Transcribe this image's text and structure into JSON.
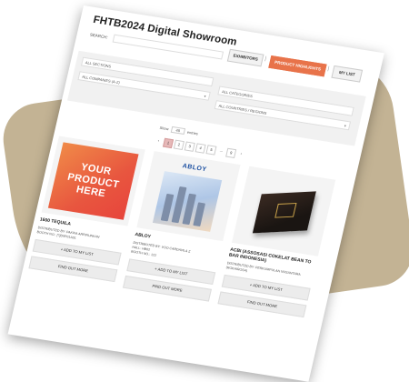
{
  "title": "FHTB2024 Digital Showroom",
  "search": {
    "label": "SEARCH:",
    "value": ""
  },
  "nav": {
    "exhibitors": "EXHIBITORS",
    "product_highlights": "PRODUCT HIGHLIGHTS",
    "my_list": "MY LIST",
    "separator": "|"
  },
  "filters": {
    "sections": "ALL SECTIONS",
    "companies": "ALL COMPANIES (A-Z)",
    "categories": "ALL CATEGORIES",
    "countries": "ALL COUNTRIES / REGIONS",
    "caret": "▾"
  },
  "entries": {
    "show": "Show",
    "count": "48",
    "suffix": "entries"
  },
  "pagination": [
    "‹",
    "1",
    "2",
    "3",
    "4",
    "5",
    "…",
    "9",
    "›"
  ],
  "pagination_active": "1",
  "products": [
    {
      "placeholder": "YOUR PRODUCT HERE",
      "name": "1600 TEQUILA",
      "distributed_label": "DISTRIBUTED BY:",
      "distributor": "PAKPIA ARPIRUNKAN",
      "booth_label": "BOOTH NO.:",
      "booth": "[?]D0P01A01",
      "add_label": "+ ADD TO MY LIST",
      "more_label": "FIND OUT MORE"
    },
    {
      "logo": "ABLOY",
      "name": "ABLOY",
      "distributed_label": "DISTRIBUTED BY:",
      "distributor": "VOO CARDAVILA Z",
      "hall_label": "HALL:",
      "hall": "HB02",
      "booth_label": "BOOTH NO.:",
      "booth": "122",
      "add_label": "+ ADD TO MY LIST",
      "more_label": "FIND OUT MORE"
    },
    {
      "name": "ACBI (ASSOSASI COKELAT BEAN TO BAR INDONESIA)",
      "distributed_label": "DISTRIBUTED BY:",
      "distributor": "PERKUMPULAN NUSANTARA (ROKAIROSA)",
      "add_label": "+ ADD TO MY LIST",
      "more_label": "FIND OUT MORE"
    }
  ]
}
